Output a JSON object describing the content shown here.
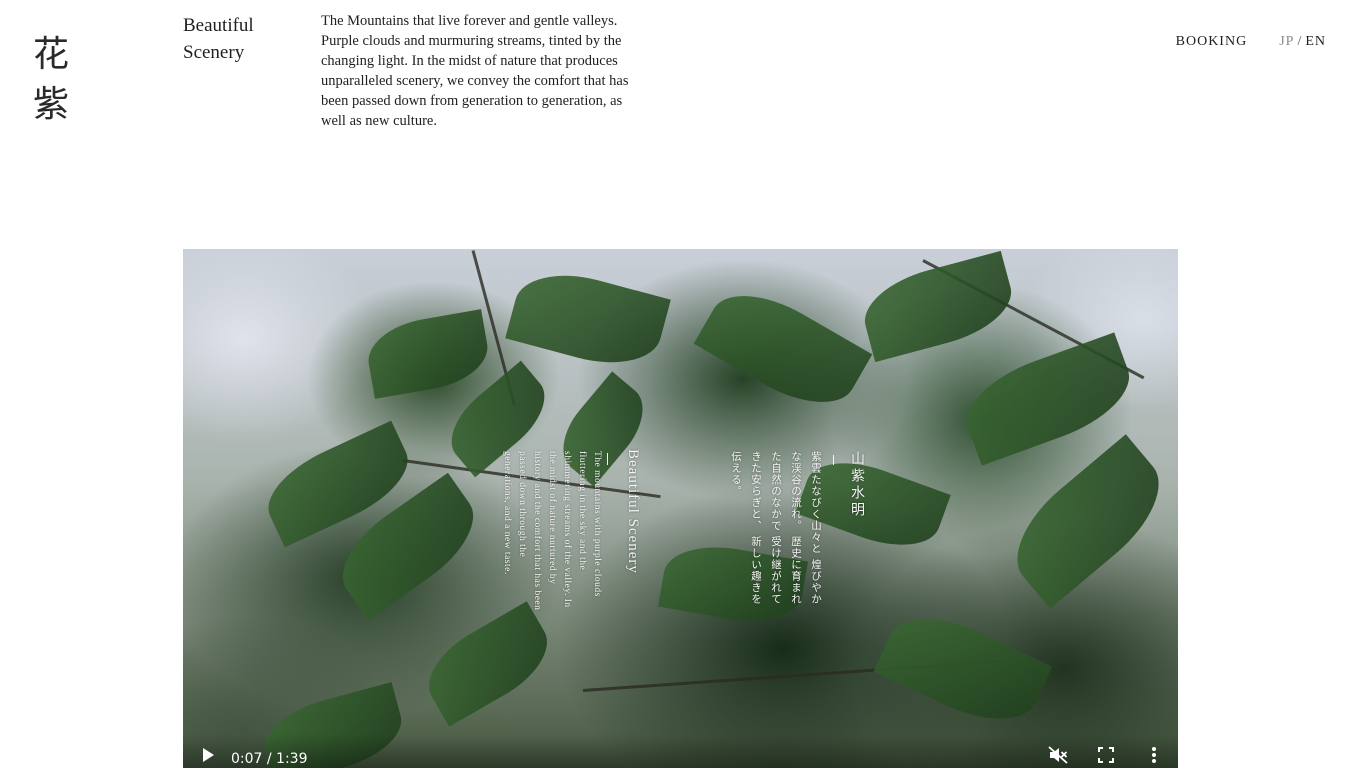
{
  "logo": {
    "char1": "花",
    "char2": "紫"
  },
  "section": {
    "title_line1": "Beautiful",
    "title_line2": "Scenery"
  },
  "intro": {
    "text": "The Mountains that live forever and gentle valleys. Purple clouds and murmuring streams, tinted by the changing light. In the midst of nature that produces unparalleled scenery, we convey the comfort that has been passed down from generation to generation, as well as new culture."
  },
  "nav": {
    "booking": "BOOKING",
    "lang_jp": "JP",
    "lang_sep": "/",
    "lang_en": "EN"
  },
  "video": {
    "overlay_en_title": "Beautiful Scenery",
    "overlay_en_body": "The mountains with purple clouds fluttering in the sky and the shimmering streams of the valley. In the midst of nature nurtured by history and the comfort that has been passed down through the generations, and a new taste.",
    "overlay_jp_title": "山紫水明",
    "overlay_jp_body": "紫雲たなびく山々と 煌びやかな渓谷の流れ。 歴史に育まれた自然のなかで 受け継がれてきた安らぎと、 新しい趣きを伝える。",
    "time": "0:07 / 1:39",
    "muted": true
  },
  "icons": {
    "play": "play-icon",
    "mute": "volume-off-icon",
    "fullscreen": "fullscreen-icon",
    "more": "more-vert-icon"
  }
}
